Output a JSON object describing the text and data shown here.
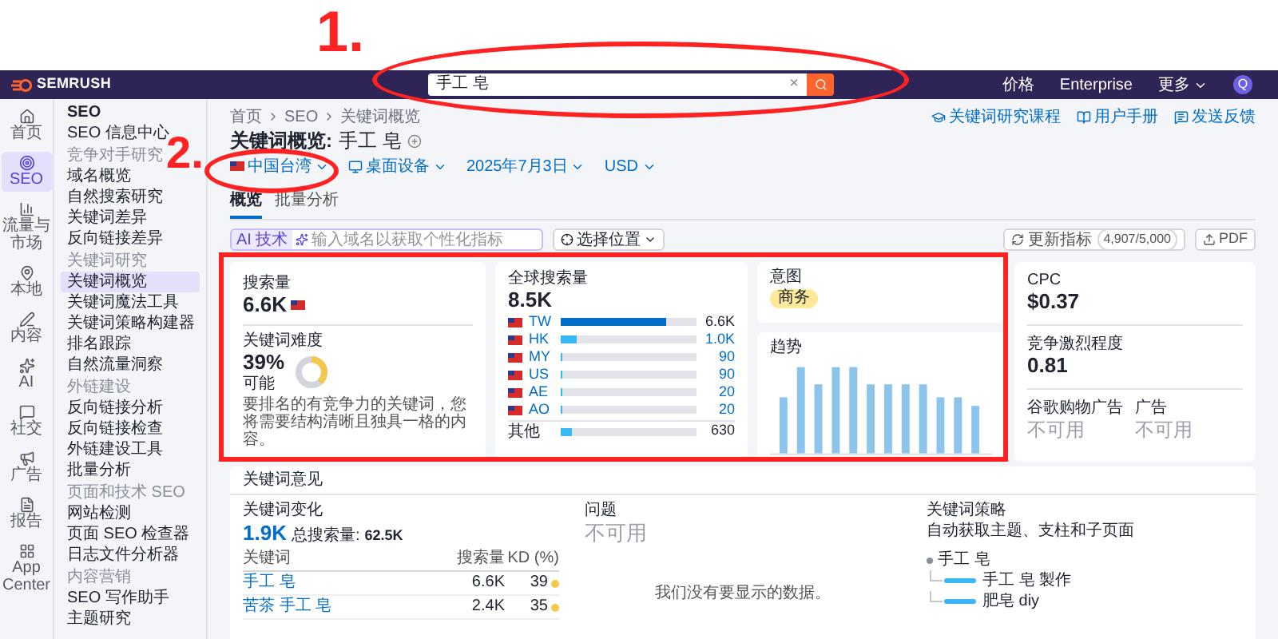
{
  "annotations": [
    {
      "label": "1."
    },
    {
      "label": "2."
    }
  ],
  "topbar": {
    "logo": "SEMRUSH",
    "search": {
      "value": "手工 皂",
      "clear": "×"
    },
    "links": [
      "价格",
      "Enterprise"
    ],
    "more": "更多",
    "avatar": "Q"
  },
  "rail": [
    {
      "label": "首页",
      "selected": false
    },
    {
      "label": "SEO",
      "selected": true
    },
    {
      "label": "流量与市场",
      "selected": false
    },
    {
      "label": "本地",
      "selected": false
    },
    {
      "label": "内容",
      "selected": false
    },
    {
      "label": "AI",
      "selected": false
    },
    {
      "label": "社交",
      "selected": false
    },
    {
      "label": "广告",
      "selected": false
    },
    {
      "label": "报告",
      "selected": false
    },
    {
      "label": "App Center",
      "selected": false
    }
  ],
  "sidebar": {
    "title": "SEO",
    "top_items": [
      {
        "label": "SEO 信息中心",
        "selected": false
      }
    ],
    "sections": [
      {
        "heading": "竞争对手研究",
        "items": [
          {
            "label": "域名概览",
            "selected": false
          },
          {
            "label": "自然搜索研究",
            "selected": false
          },
          {
            "label": "关键词差异",
            "selected": false
          },
          {
            "label": "反向链接差异",
            "selected": false
          }
        ]
      },
      {
        "heading": "关键词研究",
        "items": [
          {
            "label": "关键词概览",
            "selected": true
          },
          {
            "label": "关键词魔法工具",
            "selected": false
          },
          {
            "label": "关键词策略构建器",
            "selected": false
          },
          {
            "label": "排名跟踪",
            "selected": false
          },
          {
            "label": "自然流量洞察",
            "selected": false
          }
        ]
      },
      {
        "heading": "外链建设",
        "items": [
          {
            "label": "反向链接分析",
            "selected": false
          },
          {
            "label": "反向链接检查",
            "selected": false
          },
          {
            "label": "外链建设工具",
            "selected": false
          },
          {
            "label": "批量分析",
            "selected": false
          }
        ]
      },
      {
        "heading": "页面和技术 SEO",
        "items": [
          {
            "label": "网站检测",
            "selected": false
          },
          {
            "label": "页面 SEO 检查器",
            "selected": false
          },
          {
            "label": "日志文件分析器",
            "selected": false
          }
        ]
      },
      {
        "heading": "内容营销",
        "items": [
          {
            "label": "SEO 写作助手",
            "selected": false
          },
          {
            "label": "主题研究",
            "selected": false
          }
        ]
      }
    ]
  },
  "breadcrumb": [
    "首页",
    "SEO",
    "关键词概览"
  ],
  "top_links": [
    "关键词研究课程",
    "用户手册",
    "发送反馈"
  ],
  "page": {
    "title": "关键词概览:",
    "keyword": "手工 皂"
  },
  "filters": [
    "中国台湾",
    "桌面设备",
    "2025年7月3日",
    "USD"
  ],
  "tabs": [
    {
      "label": "概览",
      "selected": true
    },
    {
      "label": "批量分析",
      "selected": false
    }
  ],
  "ai_bar": {
    "badge": "AI 技术",
    "placeholder": "输入域名以获取个性化指标",
    "location": "选择位置"
  },
  "update": {
    "label": "更新指标",
    "count": "4,907/5,000"
  },
  "pdf": "PDF",
  "volume": {
    "label": "搜索量",
    "value": "6.6K"
  },
  "difficulty": {
    "label": "关键词难度",
    "value": "39%",
    "level": 0.39,
    "rating": "可能",
    "description": "要排名的有竞争力的关键词，您将需要结构清晰且独具一格的内容。"
  },
  "global": {
    "label": "全球搜索量",
    "value": "8.5K",
    "countries": [
      {
        "code": "TW",
        "value": "6.6K",
        "level": 0.78
      },
      {
        "code": "HK",
        "value": "1.0K",
        "level": 0.12
      },
      {
        "code": "MY",
        "value": "90",
        "level": 0.01
      },
      {
        "code": "US",
        "value": "90",
        "level": 0.01
      },
      {
        "code": "AE",
        "value": "20",
        "level": 0.01
      },
      {
        "code": "AO",
        "value": "20",
        "level": 0.01
      }
    ],
    "other": {
      "label": "其他",
      "value": "630",
      "level": 0.08
    }
  },
  "intent": {
    "label": "意图",
    "badge": "商务"
  },
  "trend": {
    "label": "趋势"
  },
  "cpc": {
    "label": "CPC",
    "value": "$0.37"
  },
  "competition": {
    "label": "竞争激烈程度",
    "value": "0.81"
  },
  "shopping_ads": {
    "label": "谷歌购物广告",
    "value": "不可用"
  },
  "ads": {
    "label": "广告",
    "value": "不可用"
  },
  "ideas": {
    "title": "关键词意见",
    "variations": {
      "label": "关键词变化",
      "value": "1.9K",
      "total_label": "总搜索量:",
      "total": "62.5K",
      "columns": [
        "关键词",
        "搜索量",
        "KD (%)"
      ],
      "rows": [
        {
          "keyword": "手工 皂",
          "volume": "6.6K",
          "kd": "39",
          "color": "#f2c94c"
        },
        {
          "keyword": "苦茶 手工 皂",
          "volume": "2.4K",
          "kd": "35",
          "color": "#f2c94c"
        }
      ]
    },
    "questions": {
      "label": "问题",
      "value": "不可用",
      "empty": "我们没有要显示的数据。"
    },
    "strategy": {
      "label": "关键词策略",
      "subtitle": "自动获取主题、支柱和子页面",
      "root": "手工 皂",
      "children": [
        {
          "label": "手工 皂 製作"
        },
        {
          "label": "肥皂 diy"
        }
      ]
    }
  }
}
